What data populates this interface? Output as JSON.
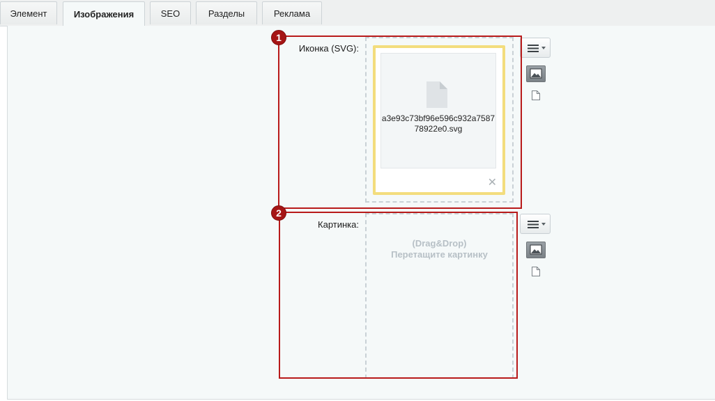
{
  "tabs": [
    {
      "label": "Элемент",
      "active": false
    },
    {
      "label": "Изображения",
      "active": true
    },
    {
      "label": "SEO",
      "active": false
    },
    {
      "label": "Разделы",
      "active": false
    },
    {
      "label": "Реклама",
      "active": false
    }
  ],
  "fields": {
    "icon": {
      "label": "Иконка (SVG):",
      "file_name": "a3e93c73bf96e596c932a758778922e0.svg",
      "remove_glyph": "✕"
    },
    "picture": {
      "label": "Картинка:",
      "dd_line1": "(Drag&Drop)",
      "dd_line2": "Перетащите картинку"
    }
  },
  "annotations": [
    {
      "number": "1"
    },
    {
      "number": "2"
    }
  ],
  "colors": {
    "annotation": "#b81a1a",
    "selected_border": "#f3dd7d",
    "panel_bg": "#f5f9f9"
  },
  "icons": {
    "menu": "hamburger-menu-icon",
    "image": "image-icon",
    "doc": "document-icon",
    "file": "file-icon"
  }
}
